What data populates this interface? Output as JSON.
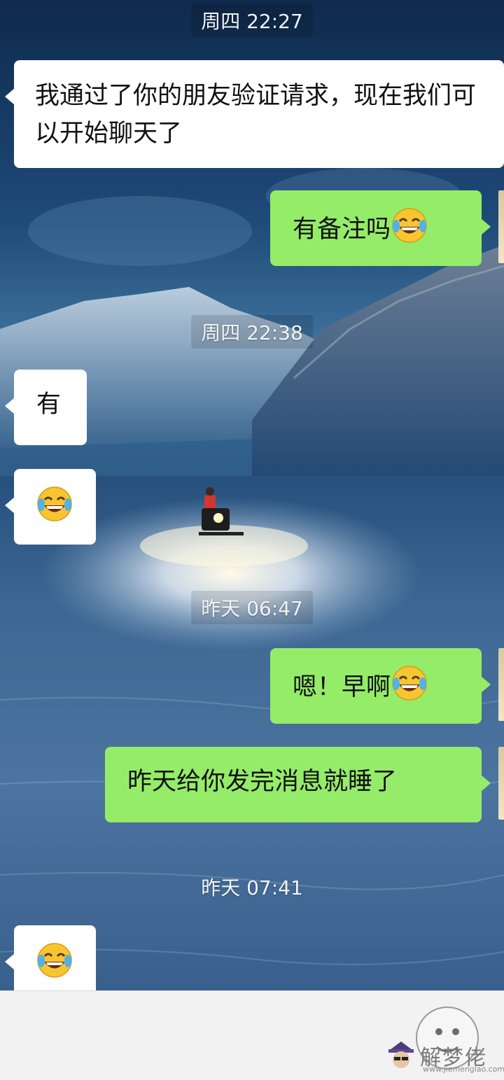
{
  "timestamps": [
    "周四 22:27",
    "周四 22:38",
    "昨天 06:47",
    "昨天 07:41"
  ],
  "messages": {
    "m1": "我通过了你的朋友验证请求，现在我们可以开始聊天了",
    "m2": "有备注吗",
    "m3": "有",
    "m5": "嗯！早啊",
    "m6": "昨天给你发完消息就睡了"
  },
  "emoji_names": [
    "tears-of-joy-emoji"
  ],
  "watermark": {
    "logo_text": "解梦佬",
    "url": "www.jiemenglao.com"
  },
  "colors": {
    "incoming_bubble": "#ffffff",
    "outgoing_bubble": "#95ec69",
    "emoji_face": "#f7c531"
  }
}
